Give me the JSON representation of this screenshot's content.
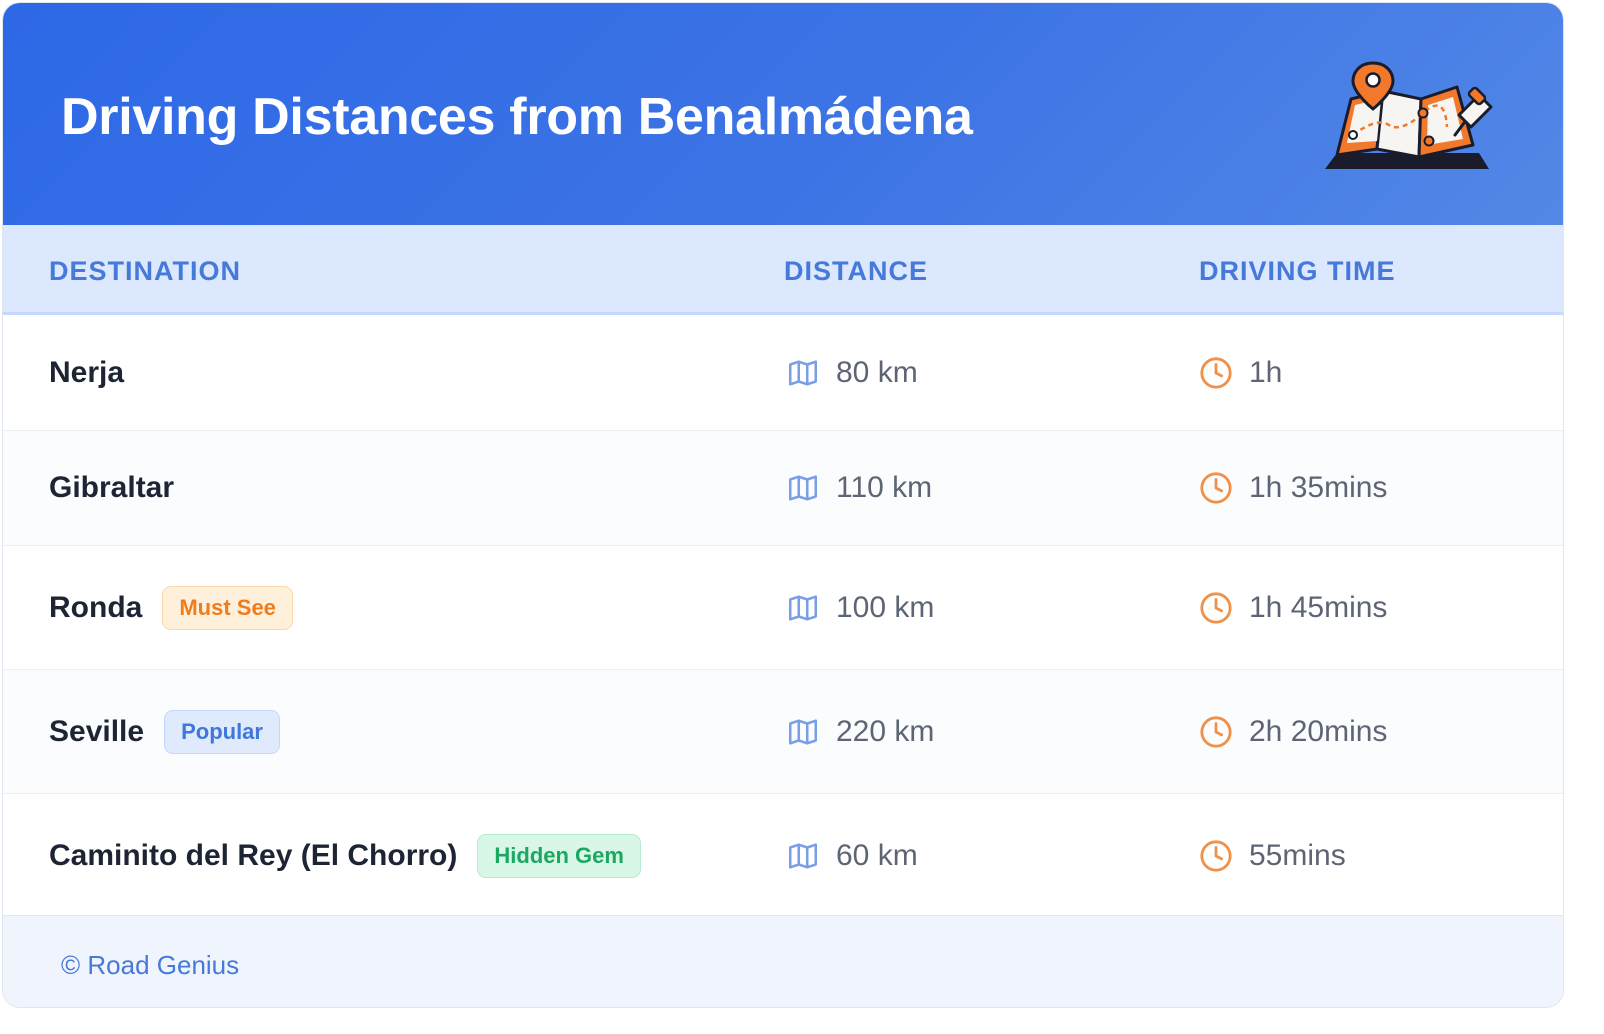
{
  "header": {
    "title": "Driving Distances from Benalmádena",
    "illustration_icon": "map-pin-illustration",
    "background_colors": [
      "#2d68e6",
      "#5288e6"
    ]
  },
  "table": {
    "columns": [
      "DESTINATION",
      "DISTANCE",
      "DRIVING TIME"
    ],
    "rows": [
      {
        "destination": "Nerja",
        "badge": "",
        "distance": "80 km",
        "time": "1h"
      },
      {
        "destination": "Gibraltar",
        "badge": "",
        "distance": "110 km",
        "time": "1h 35mins"
      },
      {
        "destination": "Ronda",
        "badge": "Must See",
        "distance": "100 km",
        "time": "1h 45mins"
      },
      {
        "destination": "Seville",
        "badge": "Popular",
        "distance": "220 km",
        "time": "2h 20mins"
      },
      {
        "destination": "Caminito del Rey (El Chorro)",
        "badge": "Hidden Gem",
        "distance": "60 km",
        "time": "55mins"
      }
    ],
    "distance_icon": "map-icon",
    "time_icon": "clock-icon",
    "colors": {
      "header_text": "#4679da",
      "must_see": "#ef7d1e",
      "popular": "#3f78da",
      "hidden_gem": "#1ca863",
      "clock": "#f0914a",
      "map": "#7b9fe6"
    }
  },
  "footer": {
    "credit": "© Road Genius"
  }
}
